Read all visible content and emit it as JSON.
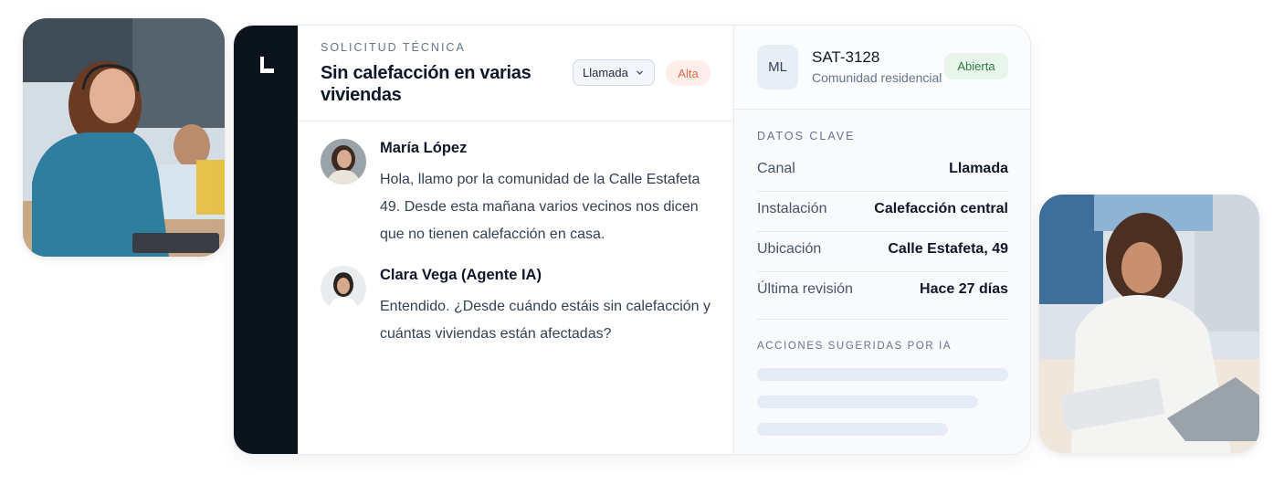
{
  "request": {
    "kicker": "SOLICITUD TÉCNICA",
    "title": "Sin calefacción en varias viviendas",
    "channel_selected": "Llamada",
    "priority": "Alta"
  },
  "messages": [
    {
      "author": "María López",
      "text": "Hola, llamo por la comunidad de la Calle Estafeta 49. Desde esta mañana varios vecinos nos dicen que no tienen calefacción en casa."
    },
    {
      "author": "Clara Vega (Agente IA)",
      "text": "Entendido. ¿Desde cuándo estáis sin calefacción y cuántas viviendas están afectadas?"
    }
  ],
  "ticket": {
    "initials": "ML",
    "id": "SAT-3128",
    "subtitle": "Comunidad residencial",
    "status": "Abierta"
  },
  "key_data": {
    "label": "DATOS CLAVE",
    "rows": [
      {
        "key": "Canal",
        "value": "Llamada"
      },
      {
        "key": "Instalación",
        "value": "Calefacción central"
      },
      {
        "key": "Ubicación",
        "value": "Calle Estafeta, 49"
      },
      {
        "key": "Última revisión",
        "value": "Hace 27 días"
      }
    ]
  },
  "suggested_actions": {
    "label": "ACCIONES SUGERIDAS POR IA"
  },
  "colors": {
    "rail": "#0b141d",
    "priority_bg": "#fdeee9",
    "priority_text": "#e26a4a",
    "status_bg": "#e7f5ea",
    "status_text": "#2f7a43"
  }
}
